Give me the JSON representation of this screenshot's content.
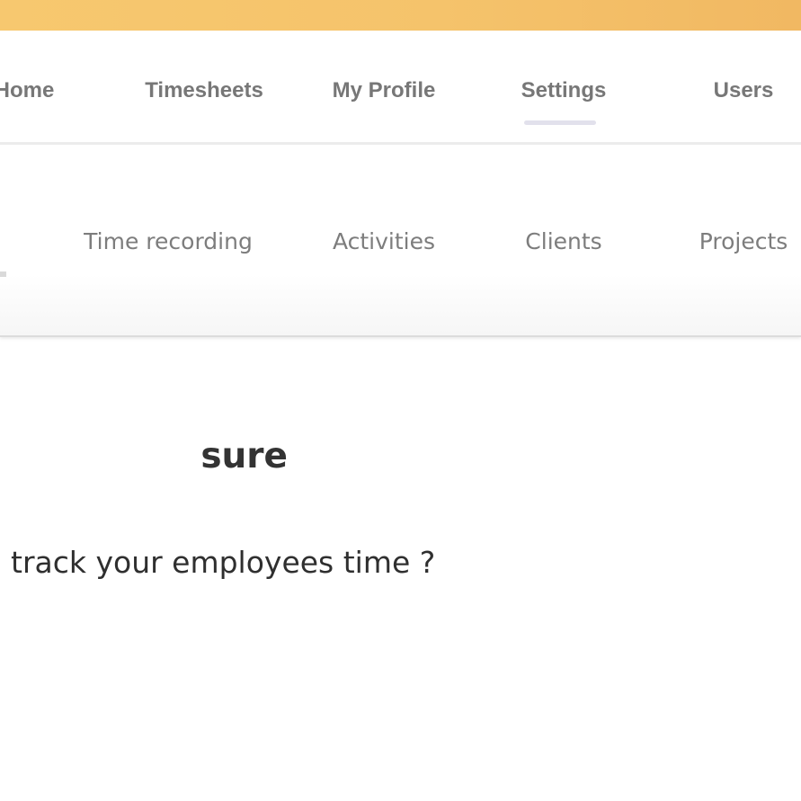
{
  "header": {
    "brand_color": "#f5c36b"
  },
  "main_nav": {
    "items": [
      {
        "label": "Home",
        "active": false
      },
      {
        "label": "Timesheets",
        "active": false
      },
      {
        "label": "My Profile",
        "active": false
      },
      {
        "label": "Settings",
        "active": true
      },
      {
        "label": "Users",
        "active": false
      }
    ]
  },
  "sub_nav": {
    "items": [
      {
        "label": "Time recording"
      },
      {
        "label": "Activities"
      },
      {
        "label": "Clients"
      },
      {
        "label": "Projects"
      }
    ]
  },
  "content": {
    "heading_visible": "sure",
    "question_visible": "track your employees time ?"
  }
}
